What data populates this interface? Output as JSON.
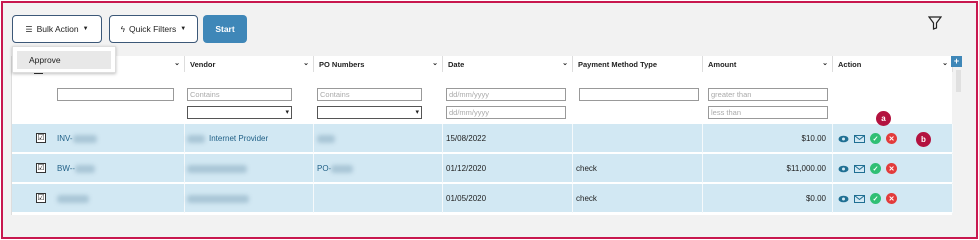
{
  "toolbar": {
    "bulk_action_label": "Bulk Action",
    "quick_filters_label": "Quick Filters",
    "start_label": "Start"
  },
  "bulk_action_menu": {
    "items": [
      {
        "label": "Approve"
      }
    ]
  },
  "columns": [
    {
      "label": "Vendor"
    },
    {
      "label": "PO Numbers"
    },
    {
      "label": "Date"
    },
    {
      "label": "Payment Method Type"
    },
    {
      "label": "Amount"
    },
    {
      "label": "Action"
    }
  ],
  "filters": {
    "vendor_placeholder": "Contains",
    "po_placeholder": "Contains",
    "date_from_placeholder": "dd/mm/yyyy",
    "date_to_placeholder": "dd/mm/yyyy",
    "amount_min_placeholder": "greater than",
    "amount_max_placeholder": "less than"
  },
  "rows": [
    {
      "invoice_prefix": "INV-",
      "vendor": "Internet Provider",
      "po_prefix": "",
      "date": "15/08/2022",
      "payment_method": "",
      "amount": "$10.00"
    },
    {
      "invoice_prefix": "BW--",
      "vendor": "",
      "po_prefix": "PO-",
      "date": "01/12/2020",
      "payment_method": "check",
      "amount": "$11,000.00"
    },
    {
      "invoice_prefix": "",
      "vendor": "",
      "po_prefix": "",
      "date": "01/05/2020",
      "payment_method": "check",
      "amount": "$0.00"
    }
  ],
  "callouts": {
    "a": "a",
    "b": "b"
  },
  "icons": {
    "bulk": "list-icon",
    "quick": "lightning-icon",
    "filter": "funnel-icon",
    "view": "eye-icon",
    "email": "envelope-icon",
    "approve": "check-circle-icon",
    "reject": "x-circle-icon"
  },
  "colors": {
    "accent": "#3f87b8",
    "row_bg": "#d2e8f3",
    "frame": "#c8184f",
    "approve": "#2fbf74",
    "reject": "#e23b3b"
  }
}
